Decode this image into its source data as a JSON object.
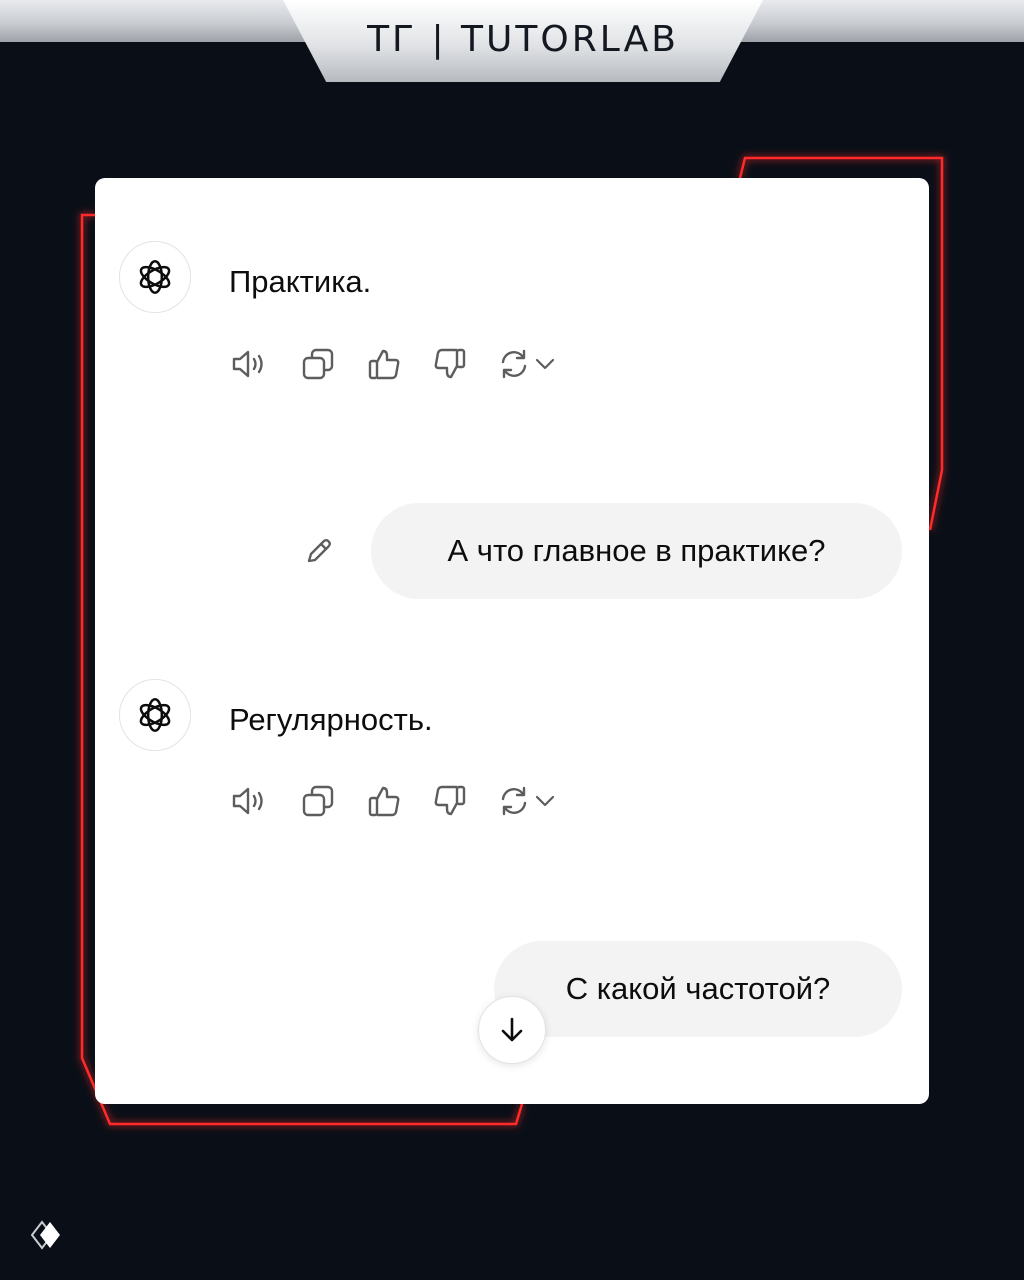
{
  "header": {
    "brand": "ТГ | TUTORLAB"
  },
  "theme": {
    "frame_glow": "#e02020",
    "background": "#0a0f17",
    "bubble_bg": "#f3f3f3"
  },
  "chat": {
    "messages": [
      {
        "role": "assistant",
        "text": "Практика.",
        "avatar_icon": "openai-logo-icon",
        "actions": [
          "read-aloud-icon",
          "copy-icon",
          "thumbs-up-icon",
          "thumbs-down-icon",
          "regenerate-icon",
          "chevron-down-icon"
        ]
      },
      {
        "role": "user",
        "text": "А что главное в практике?",
        "edit_icon": "pencil-icon"
      },
      {
        "role": "assistant",
        "text": "Регулярность.",
        "avatar_icon": "openai-logo-icon",
        "actions": [
          "read-aloud-icon",
          "copy-icon",
          "thumbs-up-icon",
          "thumbs-down-icon",
          "regenerate-icon",
          "chevron-down-icon"
        ]
      },
      {
        "role": "user",
        "text": "С какой частотой?"
      }
    ],
    "scroll_button_icon": "arrow-down-icon"
  },
  "footer": {
    "logo_icon": "tutorlab-logo-icon"
  }
}
